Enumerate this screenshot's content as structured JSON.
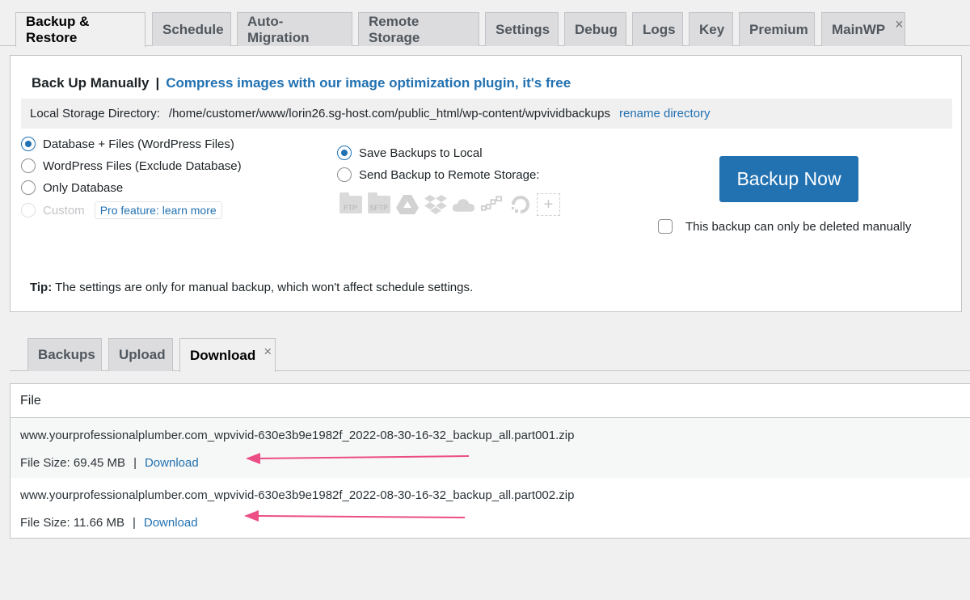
{
  "nav_tabs": [
    {
      "label": "Backup & Restore",
      "active": true
    },
    {
      "label": "Schedule"
    },
    {
      "label": "Auto-Migration"
    },
    {
      "label": "Remote Storage"
    },
    {
      "label": "Settings"
    },
    {
      "label": "Debug"
    },
    {
      "label": "Logs"
    },
    {
      "label": "Key"
    },
    {
      "label": "Premium"
    },
    {
      "label": "MainWP",
      "closable": true,
      "close_glyph": "×"
    }
  ],
  "backup_panel": {
    "title": "Back Up Manually",
    "separator": "|",
    "promo_link": "Compress images with our image optimization plugin, it's free",
    "storage_label": "Local Storage Directory:",
    "storage_path": "/home/customer/www/lorin26.sg-host.com/public_html/wp-content/wpvividbackups",
    "rename_link": "rename directory",
    "backup_types": [
      {
        "label": "Database + Files (WordPress Files)",
        "checked": true
      },
      {
        "label": "WordPress Files (Exclude Database)",
        "checked": false
      },
      {
        "label": "Only Database",
        "checked": false
      },
      {
        "label": "Custom",
        "checked": false,
        "disabled": true
      }
    ],
    "pro_badge": "Pro feature: learn more",
    "destinations": [
      {
        "label": "Save Backups to Local",
        "checked": true
      },
      {
        "label": "Send Backup to Remote Storage:",
        "checked": false
      }
    ],
    "remote_icons": [
      "ftp-icon",
      "sftp-icon",
      "google-drive-icon",
      "dropbox-icon",
      "onedrive-icon",
      "s3-compatible-icon",
      "digitalocean-icon",
      "add-storage-icon"
    ],
    "remote_icon_labels": {
      "ftp": "FTP",
      "sftp": "SFTP",
      "plus": "+"
    },
    "backup_button": "Backup Now",
    "manual_delete_label": "This backup can only be deleted manually",
    "manual_delete_checked": false,
    "tip_label": "Tip:",
    "tip_text": " The settings are only for manual backup, which won't affect schedule settings."
  },
  "sub_tabs": [
    {
      "label": "Backups"
    },
    {
      "label": "Upload"
    },
    {
      "label": "Download",
      "active": true,
      "closable": true,
      "close_glyph": "×"
    }
  ],
  "file_table": {
    "header": "File",
    "rows": [
      {
        "name": "www.yourprofessionalplumber.com_wpvivid-630e3b9e1982f_2022-08-30-16-32_backup_all.part001.zip",
        "size": "File Size: 69.45 MB",
        "separator": "|",
        "action": "Download"
      },
      {
        "name": "www.yourprofessionalplumber.com_wpvivid-630e3b9e1982f_2022-08-30-16-32_backup_all.part002.zip",
        "size": "File Size: 11.66 MB",
        "separator": "|",
        "action": "Download"
      }
    ]
  },
  "colors": {
    "accent": "#2271b1",
    "annotation_arrow": "#ec4d84",
    "page_bg": "#f0f0f1"
  }
}
